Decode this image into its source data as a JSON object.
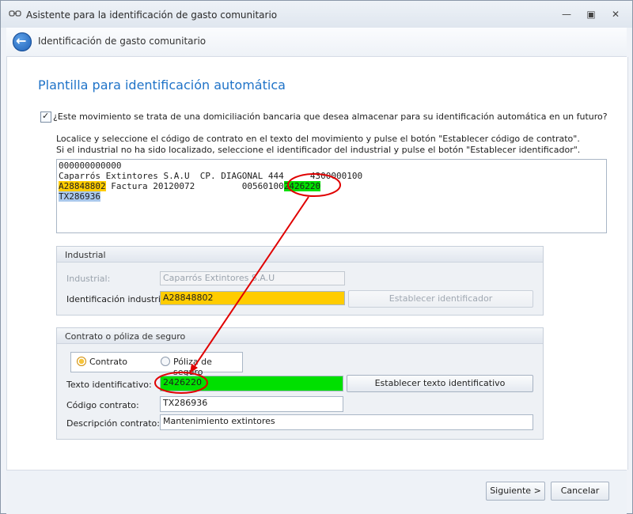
{
  "window": {
    "title": "Asistente para la identificación de gasto comunitario",
    "minimize_icon": "minimize-icon",
    "maximize_icon": "maximize-icon",
    "close_icon": "close-icon"
  },
  "header": {
    "title": "Identificación de gasto comunitario",
    "back_icon": "back-arrow-icon"
  },
  "page": {
    "title": "Plantilla para identificación automática",
    "checkbox_label": "¿Este movimiento se trata de una domiciliación bancaria que desea almacenar para su identificación automática en un futuro?",
    "checkbox_checked": true,
    "instruction_1": "Localice y seleccione el código de contrato en el texto del movimiento y pulse el botón \"Establecer código de contrato\".",
    "instruction_2": "Si el industrial no ha sido localizado, seleccione el identificador del industrial y pulse el botón \"Establecer identificador\"."
  },
  "movement_text": {
    "line1": "000000000000",
    "line2": "Caparrós Extintores S.A.U  CP. DIAGONAL 444     4300000100",
    "line3_highlight_yellow": "A28848802",
    "line3_middle": " Factura 20120072         00560100",
    "line3_highlight_green": "2426220",
    "line4_highlight_blue": "TX286936"
  },
  "industrial_group": {
    "title": "Industrial",
    "industrial_label": "Industrial:",
    "industrial_value": "Caparrós Extintores S.A.U",
    "id_label": "Identificación industrial:",
    "id_value": "A28848802",
    "set_id_button": "Establecer identificador"
  },
  "contract_group": {
    "title": "Contrato o póliza de seguro",
    "radio_contract": "Contrato",
    "radio_policy": "Póliza de seguro",
    "selected": "Contrato",
    "text_id_label": "Texto identificativo:",
    "text_id_value": "2426220",
    "set_text_button": "Establecer texto identificativo",
    "contract_code_label": "Código contrato:",
    "contract_code_value": "TX286936",
    "description_label": "Descripción contrato:",
    "description_value": "Mantenimiento extintores"
  },
  "footer": {
    "next_button": "Siguiente >",
    "cancel_button": "Cancelar"
  },
  "colors": {
    "accent_title": "#1f73c8",
    "highlight_yellow": "#ffcc00",
    "highlight_green": "#00e000",
    "highlight_blue": "#aac8ec",
    "annotation_red": "#e00000"
  }
}
